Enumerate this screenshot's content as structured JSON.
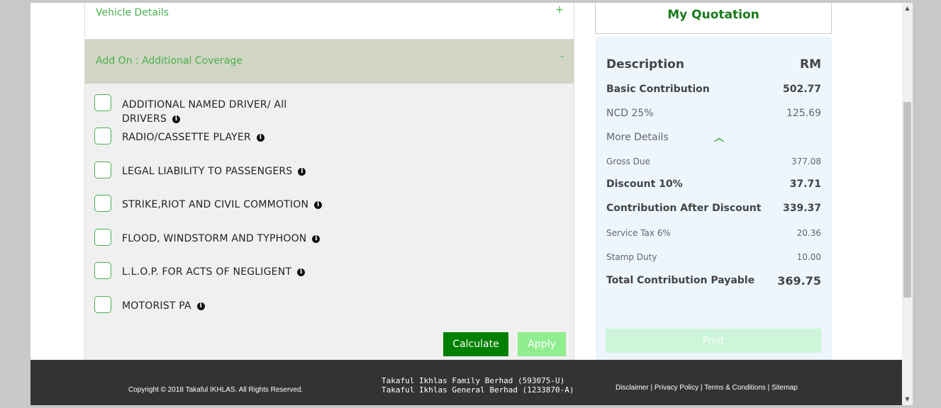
{
  "left_panel": {
    "vehicle_details": {
      "title": "Vehicle Details",
      "toggle": "+"
    },
    "addon": {
      "title": "Add On : Additional Coverage",
      "toggle": "-"
    },
    "options": [
      {
        "line1": "ADDITIONAL NAMED DRIVER/ All",
        "line2": "DRIVERS"
      },
      {
        "line1": "RADIO/CASSETTE PLAYER"
      },
      {
        "line1": "LEGAL LIABILITY TO PASSENGERS"
      },
      {
        "line1": "STRIKE,RIOT AND CIVIL COMMOTION"
      },
      {
        "line1": "FLOOD, WINDSTORM AND TYPHOON"
      },
      {
        "line1": "L.L.O.P. FOR ACTS OF NEGLIGENT"
      },
      {
        "line1": "MOTORIST PA"
      }
    ],
    "calculate_label": "Calculate",
    "apply_label": "Apply"
  },
  "quotation": {
    "title": "My Quotation",
    "header_desc": "Description",
    "header_rm": "RM",
    "basic_label": "Basic Contribution",
    "basic_value": "502.77",
    "ncd_label": "NCD 25%",
    "ncd_value": "125.69",
    "more_details": "More Details",
    "gross_label": "Gross Due",
    "gross_value": "377.08",
    "discount_label": "Discount 10%",
    "discount_value": "37.71",
    "after_label": "Contribution After Discount",
    "after_value": "339.37",
    "tax_label": "Service Tax 6%",
    "tax_value": "20.36",
    "stamp_label": "Stamp Duty",
    "stamp_value": "10.00",
    "total_label": "Total Contribution Payable",
    "total_value": "369.75",
    "print_label": "Print"
  },
  "footer": {
    "copyright": "Copyright © 2018 Takaful IKHLAS. All Rights Reserved.",
    "company1": "Takaful Ikhlas Family Berhad (593075-U)",
    "company2": "Takaful Ikhlas General Berhad (1233870-A)",
    "link_disclaimer": "Disclaimer",
    "link_privacy": "Privacy Policy",
    "link_terms": "Terms & Conditions",
    "link_sitemap": "Sitemap",
    "separator": "|"
  },
  "colors": {
    "accent_green": "#4caf50",
    "button_green": "#008000",
    "footer_bg": "#333333"
  }
}
